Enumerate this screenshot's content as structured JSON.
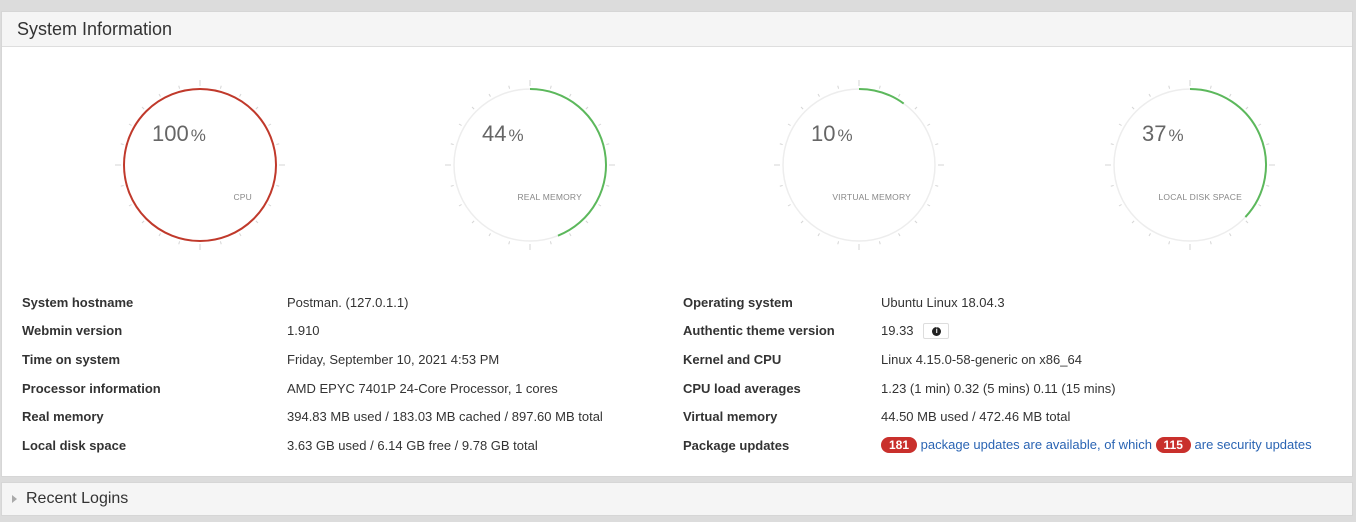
{
  "system_info": {
    "title": "System Information",
    "gauges": [
      {
        "label": "CPU",
        "value": 100,
        "unit": "%",
        "color": "#c0392b"
      },
      {
        "label": "REAL MEMORY",
        "value": 44,
        "unit": "%",
        "color": "#5cb85c"
      },
      {
        "label": "VIRTUAL MEMORY",
        "value": 10,
        "unit": "%",
        "color": "#5cb85c"
      },
      {
        "label": "LOCAL DISK SPACE",
        "value": 37,
        "unit": "%",
        "color": "#5cb85c"
      }
    ],
    "left": [
      {
        "key": "System hostname",
        "value": "Postman. (127.0.1.1)"
      },
      {
        "key": "Webmin version",
        "value": "1.910"
      },
      {
        "key": "Time on system",
        "value": "Friday, September 10, 2021 4:53 PM"
      },
      {
        "key": "Processor information",
        "value": "AMD EPYC 7401P 24-Core Processor, 1 cores"
      },
      {
        "key": "Real memory",
        "value": "394.83 MB used / 183.03 MB cached / 897.60 MB total"
      },
      {
        "key": "Local disk space",
        "value": "3.63 GB used / 6.14 GB free / 9.78 GB total"
      }
    ],
    "right": {
      "os": {
        "key": "Operating system",
        "value": "Ubuntu Linux 18.04.3"
      },
      "theme": {
        "key": "Authentic theme version",
        "value": "19.33",
        "icon": "info-icon"
      },
      "kernel": {
        "key": "Kernel and CPU",
        "value": "Linux 4.15.0-58-generic on x86_64"
      },
      "load": {
        "key": "CPU load averages",
        "value": "1.23 (1 min) 0.32 (5 mins) 0.11 (15 mins)"
      },
      "vmem": {
        "key": "Virtual memory",
        "value": "44.50 MB used / 472.46 MB total"
      },
      "updates": {
        "key": "Package updates",
        "count": "181",
        "text1": "package updates are available, of which",
        "security_count": "115",
        "text2": "are security updates"
      }
    }
  },
  "recent_logins": {
    "title": "Recent Logins",
    "icon": "caret-right-icon"
  }
}
